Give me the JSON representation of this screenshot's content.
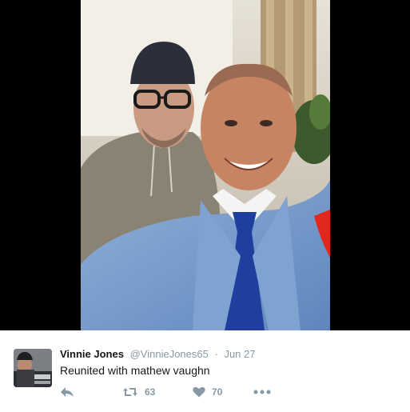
{
  "tweet": {
    "display_name": "Vinnie Jones",
    "handle": "@VinnieJones65",
    "separator": "·",
    "date": "Jun 27",
    "text": "Reunited with mathew vaughn",
    "retweet_count": "63",
    "like_count": "70"
  },
  "icons": {
    "reply": "reply-icon",
    "retweet": "retweet-icon",
    "like": "heart-icon",
    "more": "more-dots-icon"
  },
  "colors": {
    "icon_gray": "#8899a6",
    "name": "#14171a",
    "media_background": "#000000"
  }
}
